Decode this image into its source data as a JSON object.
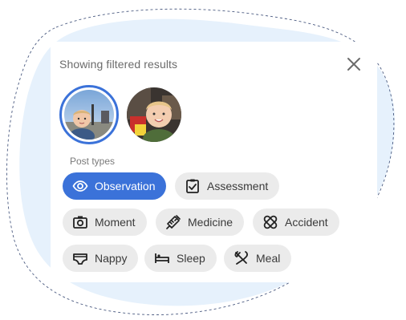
{
  "panel": {
    "title": "Showing filtered results",
    "close_icon": "close-icon"
  },
  "children": [
    {
      "avatar": "child-avatar-photo",
      "selected": true
    },
    {
      "avatar": "child-avatar-photo",
      "selected": false
    }
  ],
  "post_types": {
    "label": "Post types",
    "chips": [
      {
        "label": "Observation",
        "icon": "eye-icon",
        "selected": true
      },
      {
        "label": "Assessment",
        "icon": "clipboard-check-icon",
        "selected": false
      },
      {
        "label": "Moment",
        "icon": "camera-icon",
        "selected": false
      },
      {
        "label": "Medicine",
        "icon": "syringe-icon",
        "selected": false
      },
      {
        "label": "Accident",
        "icon": "bandage-icon",
        "selected": false
      },
      {
        "label": "Nappy",
        "icon": "nappy-icon",
        "selected": false
      },
      {
        "label": "Sleep",
        "icon": "bed-icon",
        "selected": false
      },
      {
        "label": "Meal",
        "icon": "utensils-icon",
        "selected": false
      }
    ]
  },
  "colors": {
    "accent": "#3b72d9",
    "chip_bg": "#ebebeb",
    "blob": "#e6f1fc",
    "text": "#3a3a3a"
  }
}
